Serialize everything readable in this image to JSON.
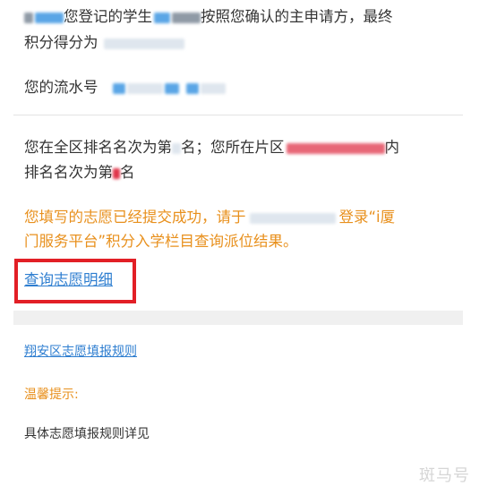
{
  "result": {
    "line1_b": "您登记的学生",
    "line1_c": "按照您确认的主申请方，最终",
    "line2": "积分得分为",
    "serial_label": "您的流水号"
  },
  "ranking": {
    "line1_a": "您在全区排名名次为第",
    "line1_b": "名；您所在片区",
    "line1_c": "内",
    "line2_a": "排名名次为第",
    "line2_b": "名"
  },
  "notice": {
    "line1_a": "您填写的志愿已经提交成功，请于",
    "line1_b": "登录“i厦",
    "line2": "门服务平台”积分入学栏目查询派位结果。"
  },
  "links": {
    "details": "查询志愿明细",
    "rules": "翔安区志愿填报规则"
  },
  "tips": {
    "title": "温馨提示:",
    "body": "具体志愿填报规则详见"
  },
  "watermark": "斑马号",
  "colors": {
    "accent_orange": "#e8901d",
    "link_blue": "#2e7ed0",
    "highlight_red": "#e21f26"
  }
}
